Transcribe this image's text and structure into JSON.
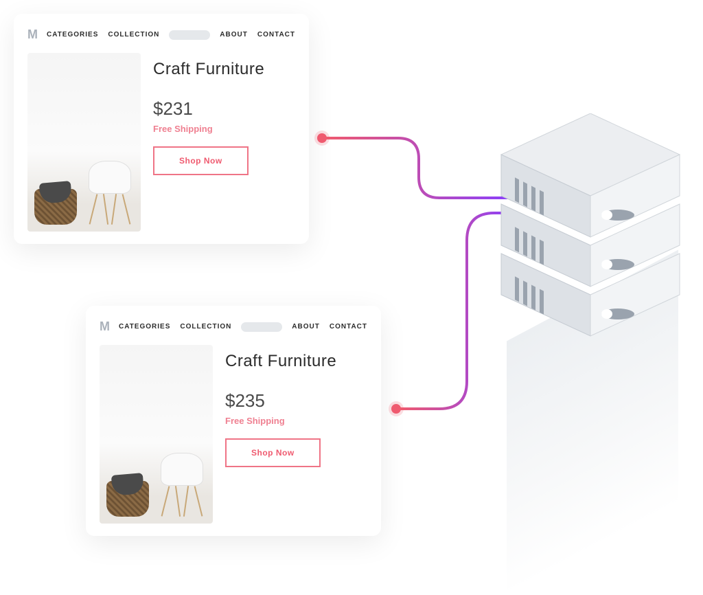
{
  "cards": [
    {
      "nav": {
        "logo": "M",
        "categories": "CATEGORIES",
        "collection": "COLLECTION",
        "about": "ABOUT",
        "contact": "CONTACT"
      },
      "product": {
        "title": "Craft Furniture",
        "price": "$231",
        "shipping": "Free Shipping",
        "cta": "Shop Now"
      }
    },
    {
      "nav": {
        "logo": "M",
        "categories": "CATEGORIES",
        "collection": "COLLECTION",
        "about": "ABOUT",
        "contact": "CONTACT"
      },
      "product": {
        "title": "Craft Furniture",
        "price": "$235",
        "shipping": "Free Shipping",
        "cta": "Shop Now"
      }
    }
  ]
}
